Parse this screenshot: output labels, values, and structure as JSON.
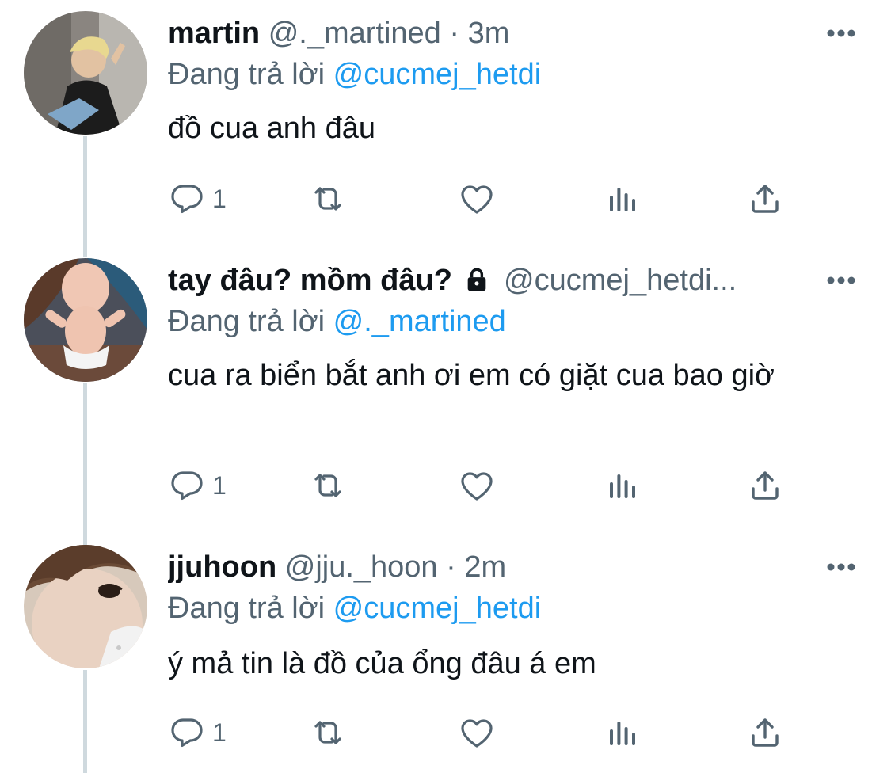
{
  "tweets": [
    {
      "display_name": "martin",
      "handle": "@._martined",
      "separator": "·",
      "time": "3m",
      "reply_prefix": "Đang trả lời",
      "reply_mention": "@cucmej_hetdi",
      "text": "đồ cua anh đâu",
      "reply_count": "1",
      "locked": false
    },
    {
      "display_name": "tay đâu? mồm đâu?",
      "handle": "@cucmej_hetdi...",
      "separator": "",
      "time": "",
      "reply_prefix": "Đang trả lời",
      "reply_mention": "@._martined",
      "text": "cua ra biển bắt anh ơi em có giặt cua bao giờ",
      "reply_count": "1",
      "locked": true
    },
    {
      "display_name": "jjuhoon",
      "handle": "@jju._hoon",
      "separator": "·",
      "time": "2m",
      "reply_prefix": "Đang trả lời",
      "reply_mention": "@cucmej_hetdi",
      "text": "ý mả tin là đồ của ổng đâu á em",
      "reply_count": "1",
      "locked": false
    }
  ],
  "icons": {
    "reply": "reply-icon",
    "retweet": "retweet-icon",
    "like": "heart-icon",
    "analytics": "analytics-icon",
    "share": "share-icon",
    "more": "more-icon",
    "lock": "lock-icon"
  },
  "colors": {
    "text": "#0f1419",
    "secondary": "#536471",
    "mention": "#1d9bf0",
    "thread_line": "#cfd9de"
  }
}
